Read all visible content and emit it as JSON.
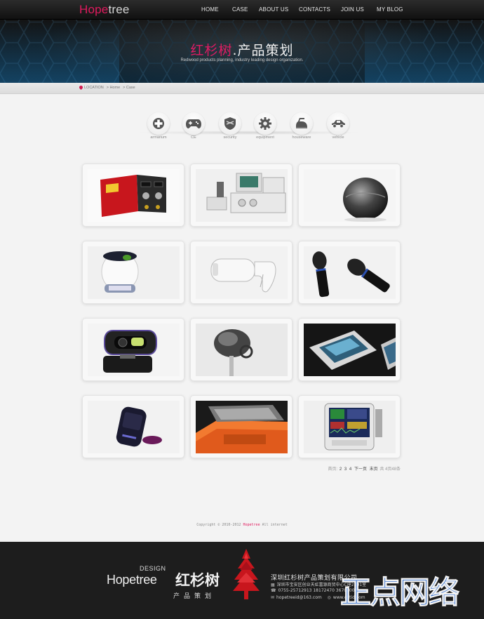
{
  "header": {
    "logo_accent": "Hope",
    "logo_rest": "tree",
    "nav": [
      {
        "label": "HOME"
      },
      {
        "label": "CASE"
      },
      {
        "label": "ABOUT US"
      },
      {
        "label": "CONTACTS"
      },
      {
        "label": "JOIN US"
      },
      {
        "label": "MY BLOG"
      }
    ],
    "hero_accent": "红杉树",
    "hero_rest": ".产品策划",
    "hero_subtitle": "Redwood products planning, industry leading design organization."
  },
  "breadcrumb": {
    "location": "LOCATION",
    "items": [
      "> Home",
      "> Case"
    ]
  },
  "categories": [
    {
      "label": "armarium",
      "icon": "medical-cross-icon"
    },
    {
      "label": "CE",
      "icon": "gamepad-icon"
    },
    {
      "label": "security",
      "icon": "shield-icon"
    },
    {
      "label": "equipment",
      "icon": "gear-icon"
    },
    {
      "label": "houseware",
      "icon": "iron-icon"
    },
    {
      "label": "vehicle",
      "icon": "car-icon"
    }
  ],
  "products": [
    {
      "name": "welding-machine"
    },
    {
      "name": "anesthesia-machine"
    },
    {
      "name": "egg-speaker"
    },
    {
      "name": "white-projector"
    },
    {
      "name": "handheld-scanner"
    },
    {
      "name": "microphones"
    },
    {
      "name": "webcam"
    },
    {
      "name": "medical-lamp"
    },
    {
      "name": "gps-device"
    },
    {
      "name": "portable-player"
    },
    {
      "name": "orange-case"
    },
    {
      "name": "patient-monitor"
    }
  ],
  "pager": {
    "first": "首页",
    "sep": ":",
    "pages": [
      "2",
      "3",
      "4"
    ],
    "next": "下一页",
    "last": "末页",
    "total": "共 4页48条"
  },
  "copyright": {
    "prefix": "Copyright © 2010-2012 ",
    "brand": "Hopetree",
    "suffix": " All internet"
  },
  "footer": {
    "design": "DESIGN",
    "logo": "Hopetree",
    "cn_name": "红杉树",
    "cn_sub": "产品策划",
    "company": "深圳红杉树产品策划有限公司",
    "address": "深圳市宝安区创业天虹富源商贸中心C座2101室",
    "phone": "0755-25712913  18172470  36702008",
    "email": "hopetreeid@163.com",
    "web": "www.chtid.com"
  },
  "watermark": "正点网络",
  "colors": {
    "accent": "#e11a5e",
    "footer_bg": "#1d1d1d",
    "watermark": "#2f6fd6"
  }
}
